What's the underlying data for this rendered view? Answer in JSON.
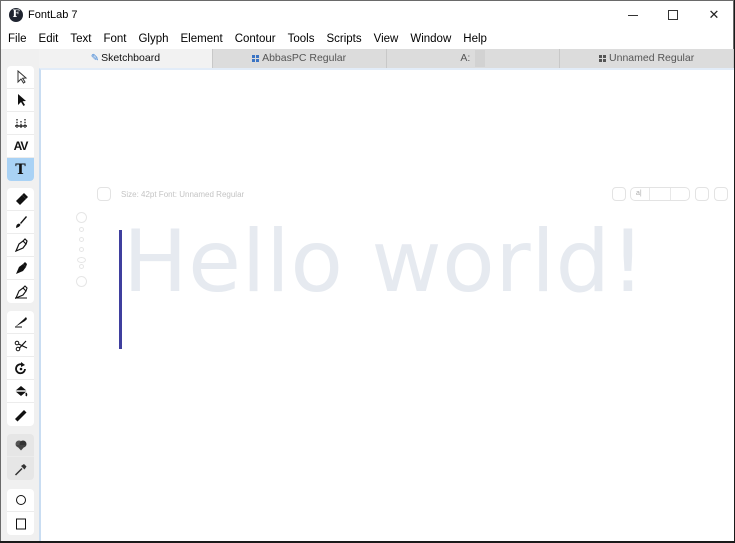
{
  "window": {
    "title": "FontLab 7",
    "logo_letter": "F",
    "controls": {
      "minimize": "minimize",
      "maximize": "maximize",
      "close": "✕"
    }
  },
  "menu": {
    "items": [
      "File",
      "Edit",
      "Text",
      "Font",
      "Glyph",
      "Element",
      "Contour",
      "Tools",
      "Scripts",
      "View",
      "Window",
      "Help"
    ]
  },
  "tabs": [
    {
      "label": "Sketchboard",
      "icon": "pen-icon",
      "active": true
    },
    {
      "label": "AbbasPC Regular",
      "icon": "font-grid-icon",
      "active": false
    },
    {
      "label": "A:",
      "icon": "",
      "active": false
    },
    {
      "label": "Unnamed Regular",
      "icon": "font-grid-icon",
      "active": false
    }
  ],
  "toolbar": {
    "groups": [
      [
        "contour-select-icon",
        "element-select-icon",
        "metrics-icon",
        "kerning-icon",
        "text-tool-icon"
      ],
      [
        "eraser-icon",
        "brush-icon",
        "pen-icon",
        "rapidograph-icon",
        "pencil-icon"
      ],
      [
        "knife-icon",
        "scissors-icon",
        "rotate-icon",
        "fill-icon",
        "ruler-icon"
      ],
      [
        "symbol-icon",
        "eyedropper-icon"
      ],
      [
        "ellipse-icon",
        "rectangle-icon"
      ]
    ],
    "active_tool": "text-tool-icon"
  },
  "canvas": {
    "info": {
      "size_label": "Size:",
      "size_value": "42pt",
      "font_label": "Font:",
      "font_value": "Unnamed Regular"
    },
    "info_text": "Size: 42pt   Font: Unnamed Regular",
    "glyph_input_value": "a|",
    "sample_text": "Hello world!",
    "colors": {
      "sample_text": "#e6eaf0",
      "cursor": "#3f3f9e",
      "active_tool": "#a9d2f5"
    }
  }
}
